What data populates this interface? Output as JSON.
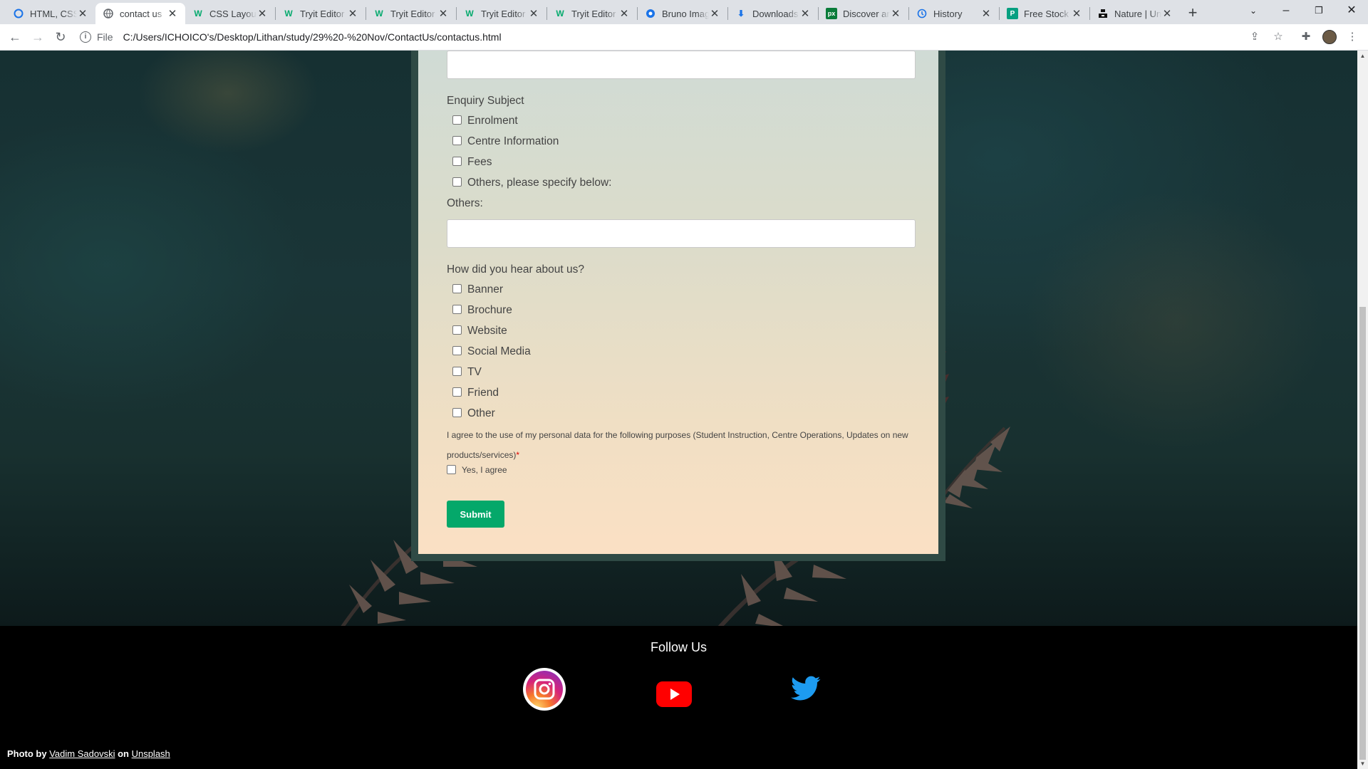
{
  "browser": {
    "tabs": [
      {
        "title": "HTML, CSS and...",
        "favicon": "opera-circle-icon",
        "active": false
      },
      {
        "title": "contact us",
        "favicon": "globe-icon",
        "active": true
      },
      {
        "title": "CSS Layout - ...",
        "favicon": "w3schools-icon",
        "active": false
      },
      {
        "title": "Tryit Editor v3...",
        "favicon": "w3schools-icon",
        "active": false
      },
      {
        "title": "Tryit Editor v3...",
        "favicon": "w3schools-icon",
        "active": false
      },
      {
        "title": "Tryit Editor v3...",
        "favicon": "w3schools-icon",
        "active": false
      },
      {
        "title": "Tryit Editor v3...",
        "favicon": "w3schools-icon",
        "active": false
      },
      {
        "title": "Bruno Images...",
        "favicon": "bruno-icon",
        "active": false
      },
      {
        "title": "Downloads",
        "favicon": "download-icon",
        "active": false
      },
      {
        "title": "Discover and...",
        "favicon": "px-icon",
        "active": false
      },
      {
        "title": "History",
        "favicon": "history-icon",
        "active": false
      },
      {
        "title": "Free Stock Ph...",
        "favicon": "pexels-icon",
        "active": false
      },
      {
        "title": "Nature | Unspl...",
        "favicon": "unsplash-icon",
        "active": false
      }
    ],
    "url_prefix": "File",
    "url": "C:/Users/ICHOICO's/Desktop/Lithan/study/29%20-%20Nov/ContactUs/contactus.html"
  },
  "form": {
    "enquiry_subject_label": "Enquiry Subject",
    "enquiry_options": [
      "Enrolment",
      "Centre Information",
      "Fees",
      "Others, please specify below:"
    ],
    "others_label": "Others:",
    "hear_label": "How did you hear about us?",
    "hear_options": [
      "Banner",
      "Brochure",
      "Website",
      "Social Media",
      "TV",
      "Friend",
      "Other"
    ],
    "consent_text": "I agree to the use of my personal data for the following purposes (Student Instruction, Centre Operations, Updates on new products/services)",
    "consent_required_mark": "*",
    "agree_label": "Yes, I agree",
    "submit_label": "Submit"
  },
  "footer": {
    "follow_label": "Follow Us",
    "social": [
      "instagram-icon",
      "youtube-icon",
      "twitter-icon"
    ],
    "credit_prefix": "Photo by ",
    "credit_author": "Vadim Sadovski",
    "credit_mid": " on ",
    "credit_site": "Unsplash"
  },
  "colors": {
    "submit_bg": "#04a86a",
    "footer_bg": "#000000",
    "form_frame": "#2f4a45"
  }
}
